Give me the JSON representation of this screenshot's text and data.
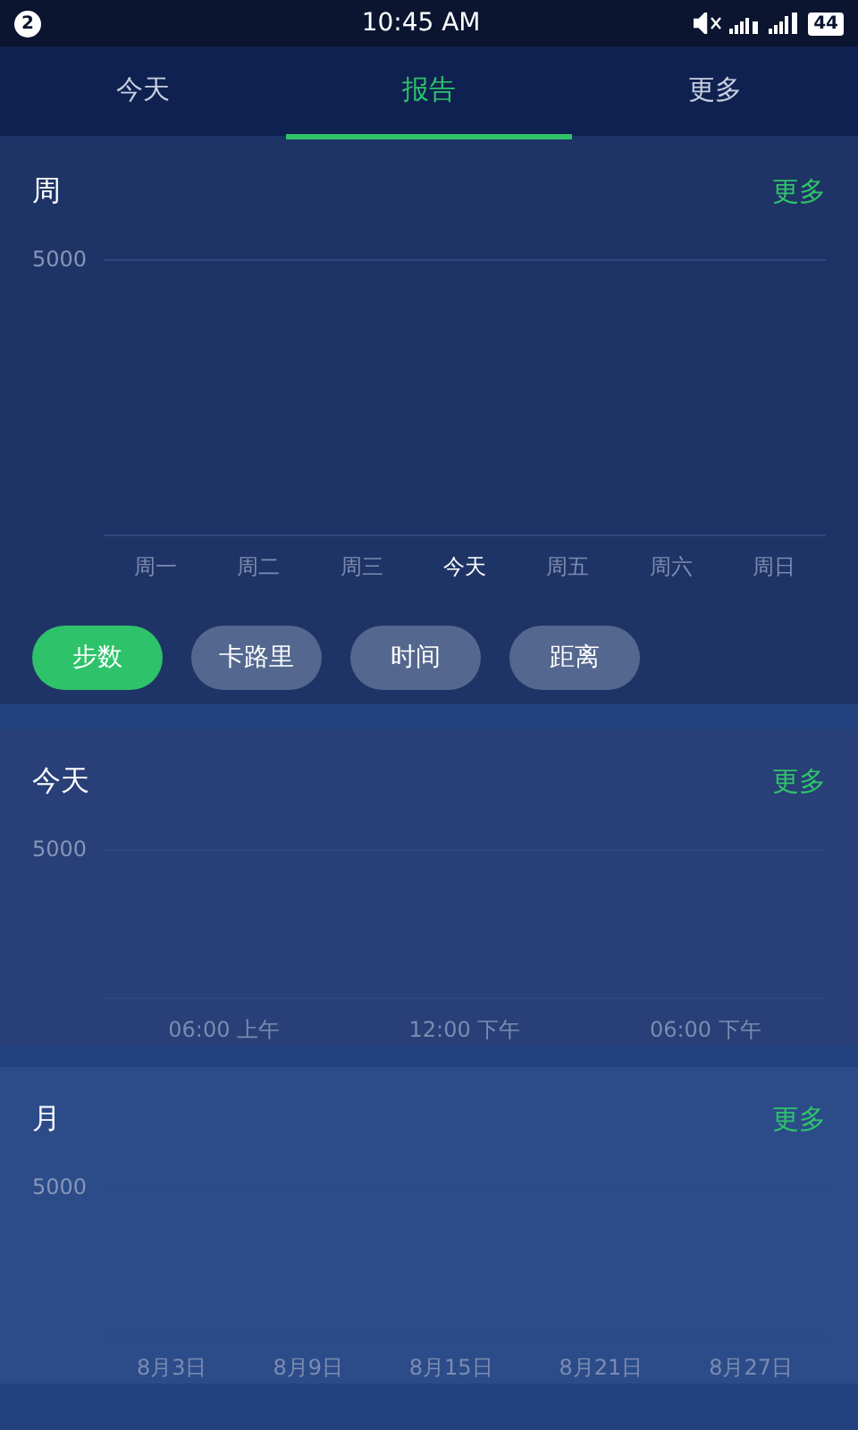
{
  "status_bar": {
    "notification_count": "2",
    "time": "10:45 AM",
    "battery": "44"
  },
  "tabs": [
    {
      "label": "今天",
      "selected": false
    },
    {
      "label": "报告",
      "selected": true
    },
    {
      "label": "更多",
      "selected": false
    }
  ],
  "sections": [
    {
      "title": "周",
      "more": "更多",
      "y_label": "5000",
      "x_labels": [
        {
          "label": "周一",
          "selected": false
        },
        {
          "label": "周二",
          "selected": false
        },
        {
          "label": "周三",
          "selected": false
        },
        {
          "label": "今天",
          "selected": true
        },
        {
          "label": "周五",
          "selected": false
        },
        {
          "label": "周六",
          "selected": false
        },
        {
          "label": "周日",
          "selected": false
        }
      ],
      "chips": [
        {
          "label": "步数",
          "selected": true
        },
        {
          "label": "卡路里",
          "selected": false
        },
        {
          "label": "时间",
          "selected": false
        },
        {
          "label": "距离",
          "selected": false
        }
      ]
    },
    {
      "title": "今天",
      "more": "更多",
      "y_label": "5000",
      "x_labels": [
        "06:00 上午",
        "12:00 下午",
        "06:00 下午"
      ]
    },
    {
      "title": "月",
      "more": "更多",
      "y_label": "5000",
      "x_labels": [
        "8月3日",
        "8月9日",
        "8月15日",
        "8月21日",
        "8月27日"
      ]
    }
  ]
}
